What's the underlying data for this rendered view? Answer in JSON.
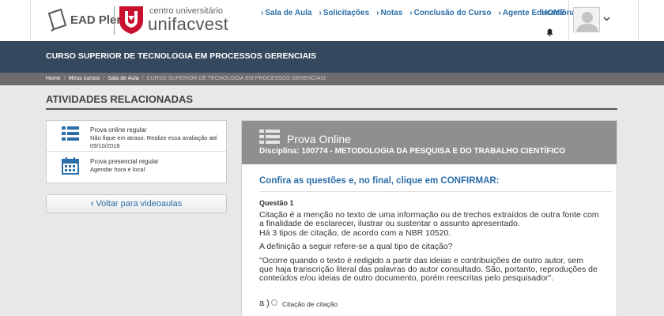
{
  "header": {
    "ead_logo": "EAD Pleno",
    "uni_small": "centro universitário",
    "uni_big": "unifacvest",
    "nav": [
      {
        "label": "Sala de Aula"
      },
      {
        "label": "Solicitações"
      },
      {
        "label": "Notas"
      },
      {
        "label": "Conclusão do Curso"
      },
      {
        "label": "Agente Educacional"
      }
    ],
    "home_label": "HOME"
  },
  "banner": {
    "course_title": "CURSO SUPERIOR DE TECNOLOGIA EM PROCESSOS GERENCIAIS"
  },
  "breadcrumb": {
    "items": [
      "Home",
      "Meus cursos",
      "Sala de Aula"
    ],
    "current": "CURSO SUPERIOR DE TECNOLOGIA EM PROCESSOS GERENCIAIS"
  },
  "section": {
    "title": "ATIVIDADES RELACIONADAS"
  },
  "activities": [
    {
      "title": "Prova online regular",
      "desc": "Não fique em atraso. Realize essa avaliação até 09/10/2018"
    },
    {
      "title": "Prova presencial regular",
      "desc": "Agendar hora e local"
    }
  ],
  "back_button": "Voltar para videoaulas",
  "exam": {
    "title": "Prova Online",
    "subject": "Disciplina: 100774 - METODOLOGIA DA PESQUISA E DO TRABALHO CIENTÍFICO",
    "instruction": "Confira as questões e, no final, clique em CONFIRMAR:",
    "question_number": "Questão 1",
    "paragraph1": "Citação é a menção no texto de uma informação ou de trechos extraídos de outra fonte com a finalidade de esclarecer, ilustrar ou sustentar o assunto apresentado.",
    "paragraph2": "Há 3 tipos de citação, de acordo com a NBR 10520.",
    "paragraph3": "A definição a seguir refere-se a qual tipo de citação?",
    "paragraph4": "\"Ocorre quando o texto é redigido a partir das ideias e contribuições de outro autor, sem que haja transcrição literal das palavras do autor consultado. São, portanto, reproduções de conteúdos e/ou ideias de outro documento, porém reescritas pelo pesquisador\".",
    "options": [
      {
        "letter": "a )",
        "text": "Citação de citação"
      }
    ]
  },
  "colors": {
    "link_blue": "#2b6ea8",
    "banner_bg": "#34495e",
    "breadcrumb_bg": "#6d6d6d",
    "exam_header_bg": "#8f8f8f",
    "brand_red": "#c8102e"
  },
  "icons": {
    "ead": "ead-pleno-logo-icon",
    "uni": "unifacvest-shield-icon",
    "bell": "bell-icon",
    "avatar": "user-avatar-icon",
    "caret": "chevron-down-icon",
    "list": "list-icon",
    "calendar": "calendar-icon"
  }
}
